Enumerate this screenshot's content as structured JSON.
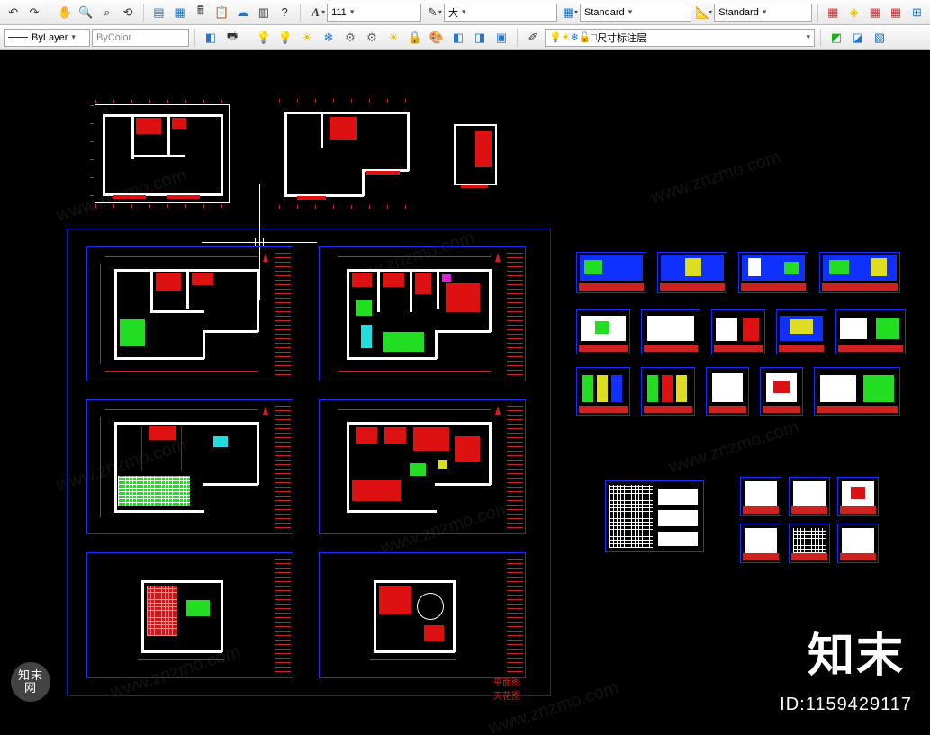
{
  "toolbar1": {
    "text_style_field": "111",
    "dim_size_field": "大",
    "dim_style1": "Standard",
    "dim_style2": "Standard"
  },
  "toolbar2": {
    "linetype_field": "ByLayer",
    "color_field": "ByColor",
    "layer_field": "尺寸标注层"
  },
  "viewport": {
    "watermark_text": "www.znzmo.com",
    "sheet_group_label_line1": "平面图",
    "sheet_group_label_line2": "天花图",
    "brand_text": "知末",
    "brand_badge_a": "知末",
    "brand_badge_b": "网",
    "id_prefix": "ID:",
    "id_value": "1159429117"
  },
  "icons": {
    "undo": "↶",
    "redo": "↷",
    "pan": "✋",
    "zoom_realtime": "🔍",
    "zoom_window": "⌕",
    "zoom_prev": "⟲",
    "props": "▤",
    "sheets": "▦",
    "calc": "🖩",
    "paste": "📋",
    "cloud": "☁",
    "calc2": "▥",
    "help": "?",
    "text_A": "A",
    "brush": "✎",
    "table": "▦",
    "ruler": "📐",
    "layer_iso": "◈",
    "printer": "🖶",
    "bulb_on": "💡",
    "bulb2": "💡",
    "sun": "☀",
    "freeze": "❄",
    "gear": "⚙",
    "gear2": "⚙",
    "sun2": "☀",
    "lock": "🔒",
    "palette": "🎨",
    "layers1": "◧",
    "layers2": "◨",
    "layers3": "▣",
    "line_tool": "—",
    "dim1": "⇔",
    "dim2": "⊞",
    "dim3": "◫",
    "annot": "✐",
    "bulb3": "💡",
    "sun3": "☀",
    "snow": "❄",
    "lock2": "🔓",
    "sq": "□",
    "layp1": "◩",
    "layp2": "◪",
    "layp3": "▧",
    "grid_red": "▦"
  }
}
